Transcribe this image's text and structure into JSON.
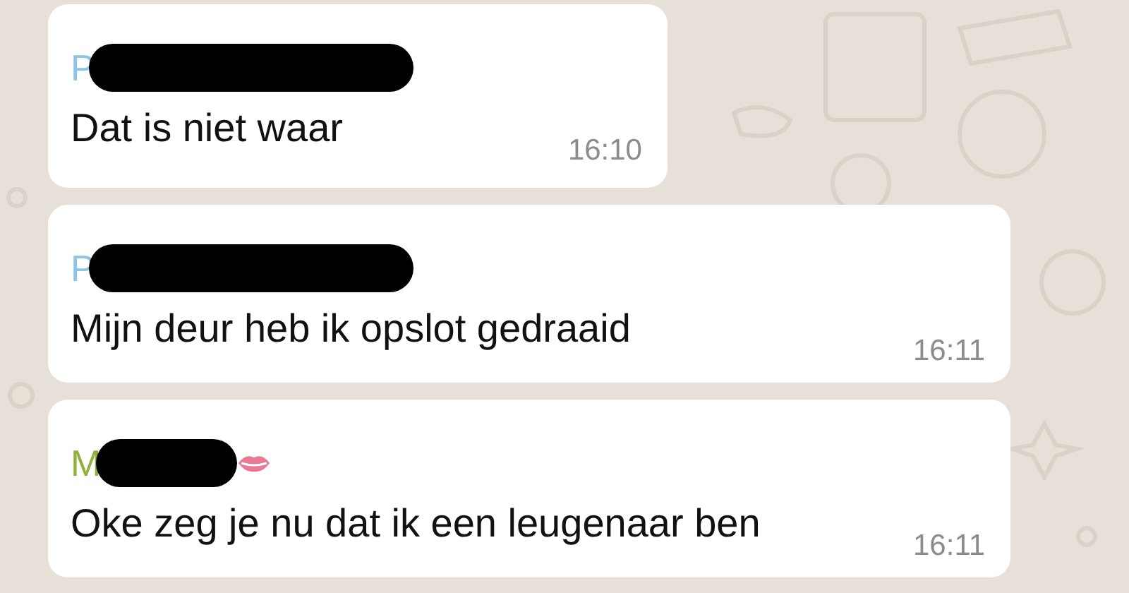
{
  "messages": [
    {
      "sender": "P",
      "color": "#8ec5e6",
      "name_redacted": true,
      "lips_icon": false,
      "text": "Dat is niet waar",
      "time": "16:10"
    },
    {
      "sender": "P",
      "color": "#8ec5e6",
      "name_redacted": true,
      "lips_icon": false,
      "text": "Mijn deur heb ik opslot gedraaid",
      "time": "16:11"
    },
    {
      "sender": "M",
      "color": "#8fb33a",
      "name_redacted": true,
      "lips_icon": true,
      "text": "Oke zeg je nu dat ik een leugenaar ben",
      "time": "16:11"
    }
  ]
}
